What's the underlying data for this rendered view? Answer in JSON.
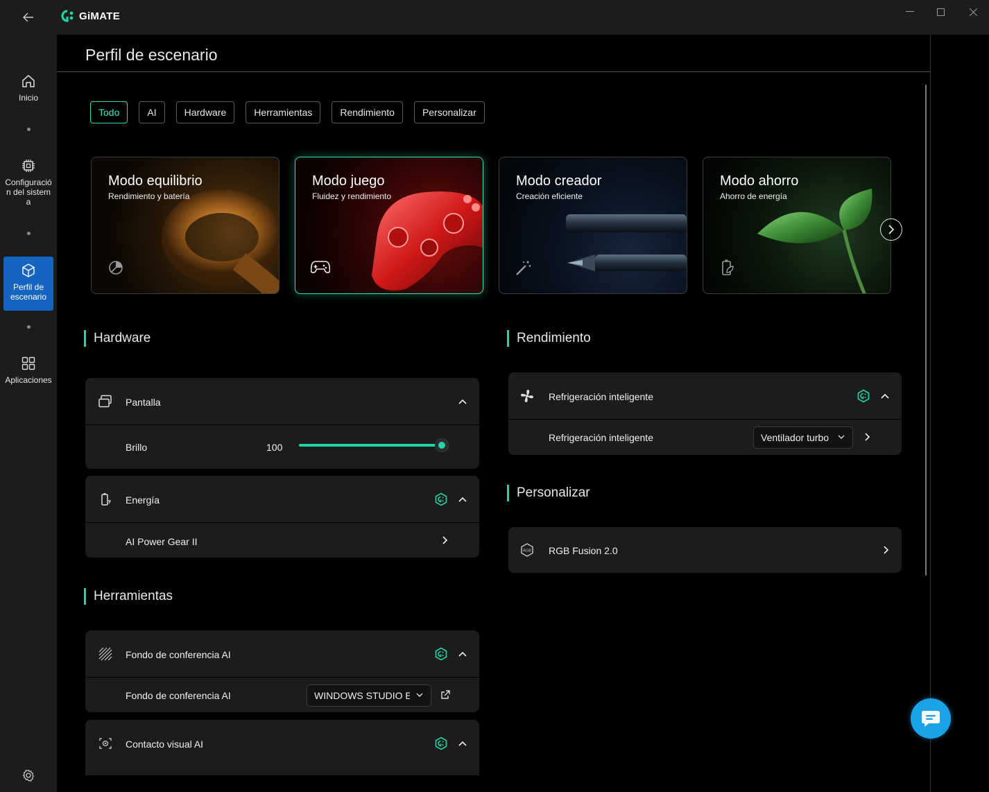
{
  "app": {
    "name": "GiMATE"
  },
  "window": {
    "minimize": "—",
    "maximize": "☐",
    "close": "✕"
  },
  "sidebar": {
    "items": [
      {
        "label": "Inicio",
        "icon": "home-icon"
      },
      {
        "label": "Configuración del sistema",
        "icon": "chip-icon"
      },
      {
        "label": "Perfil de escenario",
        "icon": "cube-icon",
        "active": true
      },
      {
        "label": "Aplicaciones",
        "icon": "grid-icon"
      }
    ],
    "settings_icon": "gear-icon"
  },
  "page": {
    "title": "Perfil de escenario"
  },
  "filters": [
    "Todo",
    "AI",
    "Hardware",
    "Herramientas",
    "Rendimiento",
    "Personalizar"
  ],
  "filters_active": "Todo",
  "modes": [
    {
      "title": "Modo equilibrio",
      "subtitle": "Rendimiento y batería",
      "icon": "balance-icon"
    },
    {
      "title": "Modo juego",
      "subtitle": "Fluidez y rendimiento",
      "icon": "gamepad-icon",
      "active": true
    },
    {
      "title": "Modo creador",
      "subtitle": "Creación eficiente",
      "icon": "magic-wand-icon"
    },
    {
      "title": "Modo ahorro",
      "subtitle": "Ahorro de energía",
      "icon": "eco-battery-icon"
    }
  ],
  "hardware": {
    "title": "Hardware",
    "pantalla": {
      "label": "Pantalla",
      "brillo_label": "Brillo",
      "brillo_value": "100",
      "brillo_level": 100
    },
    "energia": {
      "label": "Energía",
      "sub_label": "AI Power Gear II"
    }
  },
  "herramientas": {
    "title": "Herramientas",
    "fondo": {
      "label": "Fondo de conferencia AI",
      "sub_label": "Fondo de conferencia AI",
      "dropdown_value": "WINDOWS STUDIO EFFECTS"
    },
    "contacto": {
      "label": "Contacto visual AI"
    }
  },
  "rendimiento": {
    "title": "Rendimiento",
    "refrigeracion": {
      "label": "Refrigeración inteligente",
      "sub_label": "Refrigeración inteligente",
      "dropdown_value": "Ventilador turbo"
    }
  },
  "personalizar": {
    "title": "Personalizar",
    "rgb": {
      "label": "RGB Fusion 2.0"
    }
  },
  "colors": {
    "accent": "#22d4a6",
    "active_nav": "#1565c0",
    "chat": "#1aa3e8"
  }
}
